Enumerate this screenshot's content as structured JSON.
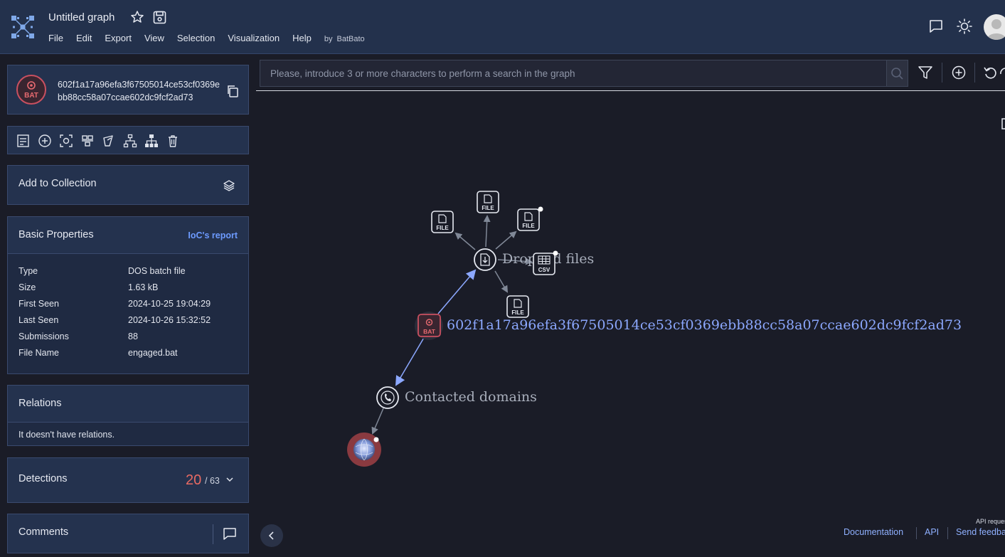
{
  "header": {
    "title": "Untitled graph",
    "menu": [
      "File",
      "Edit",
      "Export",
      "View",
      "Selection",
      "Visualization",
      "Help"
    ],
    "by_label": "by",
    "author": "BatBato"
  },
  "file": {
    "badge_text": "BAT",
    "hash": "602f1a17a96efa3f67505014ce53cf0369ebb88cc58a07ccae602dc9fcf2ad73",
    "hash_line1": "602f1a17a96efa3f67505014ce53cf0369e",
    "hash_line2": "bb88cc58a07ccae602dc9fcf2ad73"
  },
  "collection": {
    "label": "Add to Collection"
  },
  "properties": {
    "title": "Basic Properties",
    "report_link": "IoC's report",
    "rows": [
      {
        "key": "Type",
        "value": "DOS batch file"
      },
      {
        "key": "Size",
        "value": "1.63 kB"
      },
      {
        "key": "First Seen",
        "value": "2024-10-25 19:04:29"
      },
      {
        "key": "Last Seen",
        "value": "2024-10-26 15:32:52"
      },
      {
        "key": "Submissions",
        "value": "88"
      },
      {
        "key": "File Name",
        "value": "engaged.bat"
      }
    ]
  },
  "relations": {
    "title": "Relations",
    "empty": "It doesn't have relations."
  },
  "detections": {
    "title": "Detections",
    "count": "20",
    "total": "/ 63"
  },
  "comments": {
    "title": "Comments"
  },
  "search": {
    "placeholder": "Please, introduce 3 or more characters to perform a search in the graph"
  },
  "graph": {
    "center_label": "602f1a17a96efa3f67505014ce53cf0369ebb88cc58a07ccae602dc9fcf2ad73",
    "center_badge": "BAT",
    "dropped_label": "Dropped files",
    "domains_label": "Contacted domains",
    "file_badge": "FILE",
    "csv_badge": "CSV"
  },
  "footer": {
    "documentation": "Documentation",
    "api": "API",
    "feedback": "Send feedback",
    "api_requests": "API requests"
  },
  "colors": {
    "accent": "#6d9bff",
    "detections": "#e86a63",
    "bat": "#c95060",
    "edge": "#8ca8ff"
  }
}
